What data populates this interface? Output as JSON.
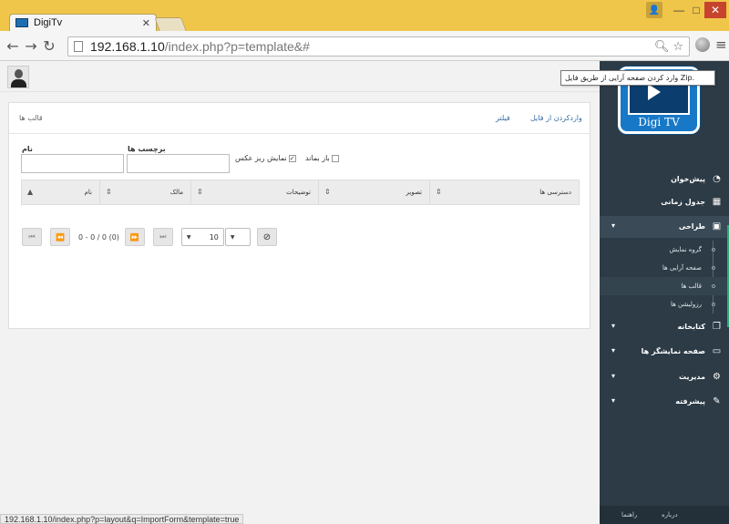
{
  "browser": {
    "tab_title": "DigiTv",
    "url_host": "192.168.1.10",
    "url_path": "/index.php?p=template&#",
    "status_url": "192.168.1.10/index.php?p=layout&q=ImportForm&template=true"
  },
  "header": {
    "panel_title": "قالب ها",
    "filter_link": "فیلتر",
    "import_link": "واردکردن از فایل"
  },
  "tooltip": "وارد کردن صفحه آرایی از طریق فایل Zip.",
  "filters": {
    "name_label": "نام",
    "tags_label": "برچسب ها",
    "show_thumbs_label": "نمایش ریز عکس",
    "keep_open_label": "باز بماند"
  },
  "table": {
    "columns": [
      "نام",
      "مالک",
      "توضیحات",
      "تصویر",
      "دسترسی ها"
    ]
  },
  "pager": {
    "info": "0 - 0 / 0 (0)",
    "page_size": "10"
  },
  "sidebar": {
    "brand": "Digi TV",
    "items": [
      {
        "label": "پیش‌خوان"
      },
      {
        "label": "جدول زمانی"
      },
      {
        "label": "طراحی"
      },
      {
        "label": "کتابخانه"
      },
      {
        "label": "صفحه نمایشگر ها"
      },
      {
        "label": "مدیریت"
      },
      {
        "label": "پیشرفته"
      }
    ],
    "subitems": [
      {
        "label": "گروه نمایش"
      },
      {
        "label": "صفحه آرایی ها"
      },
      {
        "label": "قالب ها"
      },
      {
        "label": "رزولیشن ها"
      }
    ],
    "footer_about": "درباره",
    "footer_help": "راهنما"
  }
}
